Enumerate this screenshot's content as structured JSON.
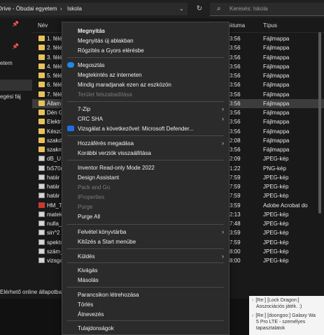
{
  "address": {
    "seg1": "Drive - Óbudai egyetem",
    "seg2": "Iskola",
    "sep": "›",
    "dropdown": "⌄",
    "refresh": "↻"
  },
  "search": {
    "placeholder": "Keresés: Iskola",
    "icon": "⌕"
  },
  "nav": {
    "item1": "etem",
    "item2": "egési fáj",
    "pin": "📌"
  },
  "columns": {
    "name": "Név",
    "date": "Dátuma",
    "type": "Típus"
  },
  "rows": [
    {
      "icon": "folder",
      "name": "1. félé",
      "date": "3:56",
      "type": "Fájlmappa"
    },
    {
      "icon": "folder",
      "name": "2. félé",
      "date": "3:56",
      "type": "Fájlmappa"
    },
    {
      "icon": "folder",
      "name": "3. félé",
      "date": "3:56",
      "type": "Fájlmappa"
    },
    {
      "icon": "folder",
      "name": "4. félé",
      "date": "3:56",
      "type": "Fájlmappa"
    },
    {
      "icon": "folder",
      "name": "5. félé",
      "date": "3:56",
      "type": "Fájlmappa"
    },
    {
      "icon": "folder",
      "name": "6. félé",
      "date": "3:56",
      "type": "Fájlmappa"
    },
    {
      "icon": "folder",
      "name": "7. félé",
      "date": "3:56",
      "type": "Fájlmappa"
    },
    {
      "icon": "folder",
      "name": "Állam",
      "date": "3:56",
      "type": "Fájlmappa"
    },
    {
      "icon": "folder",
      "name": "Dén G",
      "date": "3:56",
      "type": "Fájlmappa"
    },
    {
      "icon": "folder",
      "name": "Elektr",
      "date": "3:56",
      "type": "Fájlmappa"
    },
    {
      "icon": "folder",
      "name": "Készül",
      "date": "3:56",
      "type": "Fájlmappa"
    },
    {
      "icon": "folder",
      "name": "szakd",
      "date": "2:08",
      "type": "Fájlmappa"
    },
    {
      "icon": "folder",
      "name": "szakm",
      "date": "3:56",
      "type": "Fájlmappa"
    },
    {
      "icon": "img",
      "name": "dB_U",
      "date": "2:09",
      "type": "JPEG-kép"
    },
    {
      "icon": "img",
      "name": "fx570n",
      "date": "1:22",
      "type": "PNG-kép"
    },
    {
      "icon": "img",
      "name": "határ",
      "date": "7:59",
      "type": "JPEG-kép"
    },
    {
      "icon": "img",
      "name": "határ",
      "date": "7:59",
      "type": "JPEG-kép"
    },
    {
      "icon": "img",
      "name": "határ",
      "date": "7:59",
      "type": "JPEG-kép"
    },
    {
      "icon": "pdf",
      "name": "HM_T",
      "date": "3:59",
      "type": "Adobe Acrobat do"
    },
    {
      "icon": "img",
      "name": "matek",
      "date": "2:13",
      "type": "JPEG-kép"
    },
    {
      "icon": "img",
      "name": "nulla_",
      "date": "7:48",
      "type": "JPEG-kép"
    },
    {
      "icon": "img",
      "name": "sin^2",
      "date": "3:59",
      "type": "JPEG-kép"
    },
    {
      "icon": "img",
      "name": "spektr",
      "date": "7:59",
      "type": "JPEG-kép"
    },
    {
      "icon": "img",
      "name": "szám_",
      "date": "8:00",
      "type": "JPEG-kép"
    },
    {
      "icon": "img",
      "name": "vizsga",
      "date": "8:00",
      "type": "JPEG-kép"
    }
  ],
  "status": "Elérhető online állapotba",
  "forum": {
    "line1": "[Re:] [Lock Dragon:]",
    "line2": "Asszociációs játék. :)",
    "line3": "[Re:] [doongoo:] Galaxy Wa",
    "line4": "5 Pro LTE - személyes",
    "line5": "tapasztalatok",
    "arrow": "›"
  },
  "menu": {
    "items": [
      {
        "label": "Megnyitás",
        "style": "bold"
      },
      {
        "label": "Megnyitás új ablakban"
      },
      {
        "label": "Rögzítés a Gyors elérésbe"
      },
      {
        "label": "Megosztás",
        "icon": "cloud"
      },
      {
        "label": "Megtekintés az interneten"
      },
      {
        "label": "Mindig maradjanak ezen az eszközön"
      },
      {
        "label": "Terület felszabadítása",
        "style": "disabled"
      },
      {
        "label": "7-Zip",
        "arrow": "›"
      },
      {
        "label": "CRC SHA",
        "arrow": "›"
      },
      {
        "label": "Vizsgálat a következővel: Microsoft Defender...",
        "icon": "shield"
      },
      {
        "label": "Hozzáférés megadása",
        "arrow": "›"
      },
      {
        "label": "Korábbi verziók visszaállítása"
      },
      {
        "label": "Inventor Read-only Mode 2022"
      },
      {
        "label": "Design Assistant"
      },
      {
        "label": "Pack and Go",
        "style": "disabled"
      },
      {
        "label": "iProperties",
        "style": "disabled"
      },
      {
        "label": "Purge",
        "style": "disabled"
      },
      {
        "label": "Purge All"
      },
      {
        "label": "Felvétel könyvtárba",
        "arrow": "›"
      },
      {
        "label": "Kitűzés a Start menübe"
      },
      {
        "label": "Küldés",
        "arrow": "›"
      },
      {
        "label": "Kivágás"
      },
      {
        "label": "Másolás"
      },
      {
        "label": "Parancsikon létrehozása"
      },
      {
        "label": "Törlés"
      },
      {
        "label": "Átnevezés"
      },
      {
        "label": "Tulajdonságok"
      }
    ]
  },
  "colors": {
    "folder": "#e8c25a",
    "accent": "#1d8ae8",
    "menu_bg": "#2b2b2b"
  }
}
